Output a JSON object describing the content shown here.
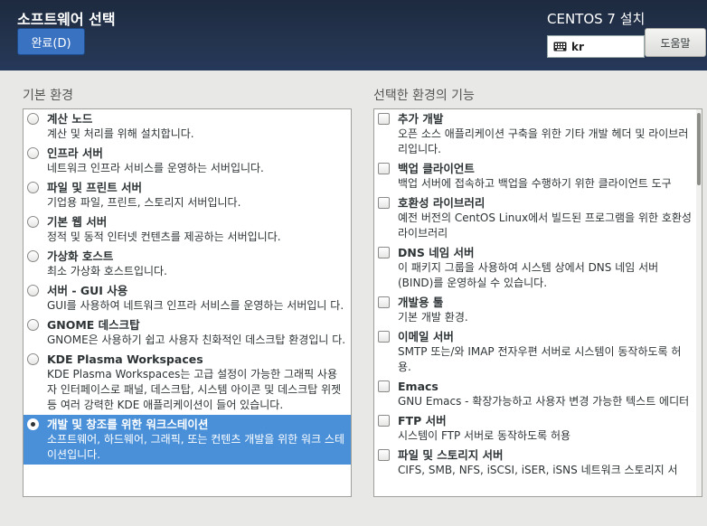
{
  "header": {
    "title": "소프트웨어 선택",
    "done_label": "완료(D)",
    "install_title": "CENTOS 7 설치",
    "keyboard_value": "kr",
    "help_label": "도움말"
  },
  "env_section": {
    "label": "기본 환경",
    "items": [
      {
        "name": "계산 노드",
        "desc": "계산 및 처리를 위해 설치합니다."
      },
      {
        "name": "인프라 서버",
        "desc": "네트워크 인프라 서비스를 운영하는 서버입니다."
      },
      {
        "name": "파일 및 프린트 서버",
        "desc": "기업용 파일, 프린트, 스토리지 서버입니다."
      },
      {
        "name": "기본 웹 서버",
        "desc": "정적 및 동적 인터넷 컨텐츠를 제공하는 서버입니다."
      },
      {
        "name": "가상화 호스트",
        "desc": "최소 가상화 호스트입니다."
      },
      {
        "name": "서버 - GUI 사용",
        "desc": "GUI를 사용하여 네트워크 인프라 서비스를 운영하는 서버입니 다."
      },
      {
        "name": "GNOME 데스크탑",
        "desc": "GNOME은 사용하기 쉽고 사용자 친화적인 데스크탑 환경입니 다."
      },
      {
        "name": "KDE Plasma Workspaces",
        "desc": "KDE Plasma Workspaces는 고급 설정이 가능한 그래픽 사용자 인터페이스로 패널, 데스크탑, 시스템 아이콘 및 데스크탑 위젯 등 여러 강력한 KDE 애플리케이션이 들어 있습니다."
      },
      {
        "name": "개발 및 창조를 위한 워크스테이션",
        "desc": "소프트웨어, 하드웨어, 그래픽, 또는 컨텐츠 개발을 위한 워크 스테이션입니다."
      }
    ]
  },
  "addon_section": {
    "label": "선택한 환경의 기능",
    "items": [
      {
        "name": "추가 개발",
        "desc": "오픈 소스 애플리케이션 구축을 위한 기타 개발 헤더 및 라이브러리입니다."
      },
      {
        "name": "백업 클라이언트",
        "desc": "백업 서버에 접속하고 백업을 수행하기 위한 클라이언트 도구"
      },
      {
        "name": "호환성 라이브러리",
        "desc": "예전 버전의 CentOS Linux에서 빌드된 프로그램을 위한 호환성 라이브러리"
      },
      {
        "name": "DNS 네임 서버",
        "desc": "이 패키지 그룹을 사용하여 시스템 상에서 DNS 네임 서버 (BIND)를 운영하실 수 있습니다."
      },
      {
        "name": "개발용 툴",
        "desc": "기본 개발 환경."
      },
      {
        "name": "이메일 서버",
        "desc": "SMTP 또는/와 IMAP 전자우편 서버로 시스템이 동작하도록 허용."
      },
      {
        "name": "Emacs",
        "desc": "GNU Emacs - 확장가능하고 사용자 변경 가능한 텍스트 에디터"
      },
      {
        "name": "FTP 서버",
        "desc": "시스템이 FTP 서버로 동작하도록 허용"
      },
      {
        "name": "파일 및 스토리지 서버",
        "desc": "CIFS, SMB, NFS, iSCSI, iSER, iSNS 네트워크 스토리지 서"
      }
    ]
  }
}
